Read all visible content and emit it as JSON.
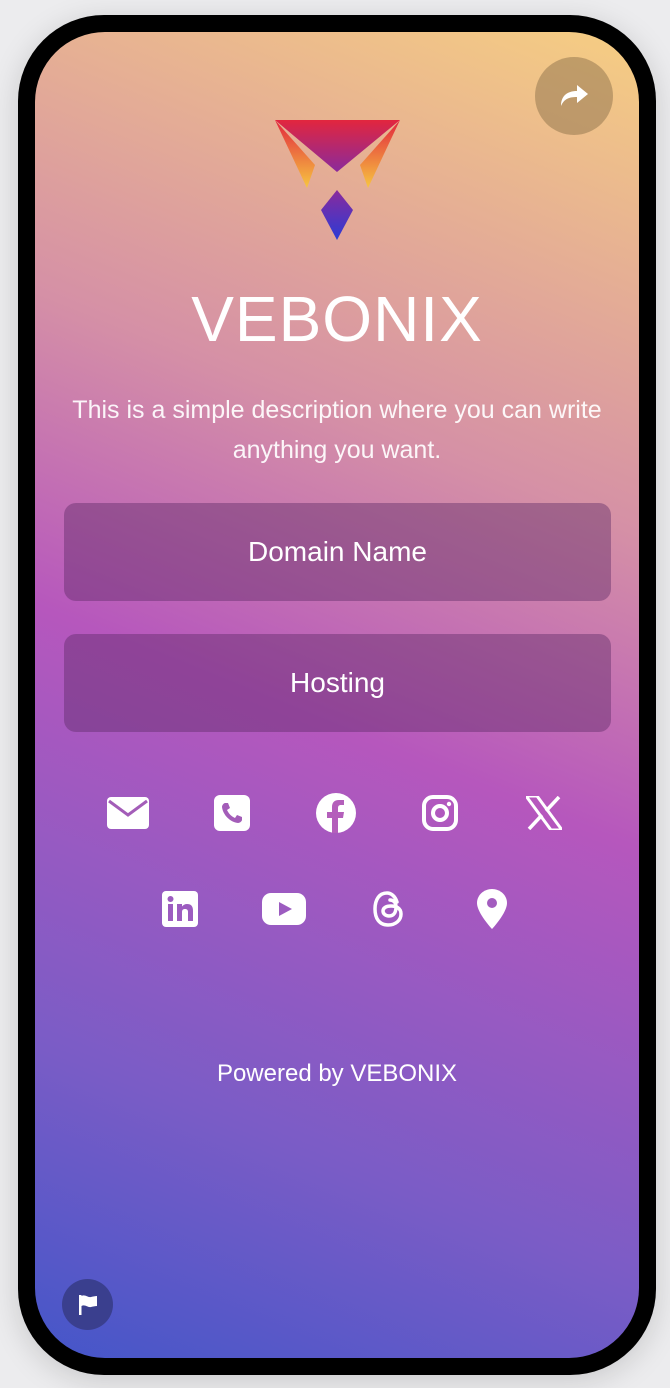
{
  "profile": {
    "title": "VEBONIX",
    "description": "This is a simple description where you can write anything you want."
  },
  "links": [
    {
      "label": "Domain Name"
    },
    {
      "label": "Hosting"
    }
  ],
  "social_icons": [
    "email-icon",
    "phone-icon",
    "facebook-icon",
    "instagram-icon",
    "x-icon",
    "linkedin-icon",
    "youtube-icon",
    "threads-icon",
    "location-icon"
  ],
  "footer": {
    "powered_by": "Powered by VEBONIX"
  },
  "colors": {
    "gradient_start": "#4456c9",
    "gradient_mid": "#b657bd",
    "gradient_end": "#f6ce82",
    "button_bg": "#6a3a78"
  }
}
